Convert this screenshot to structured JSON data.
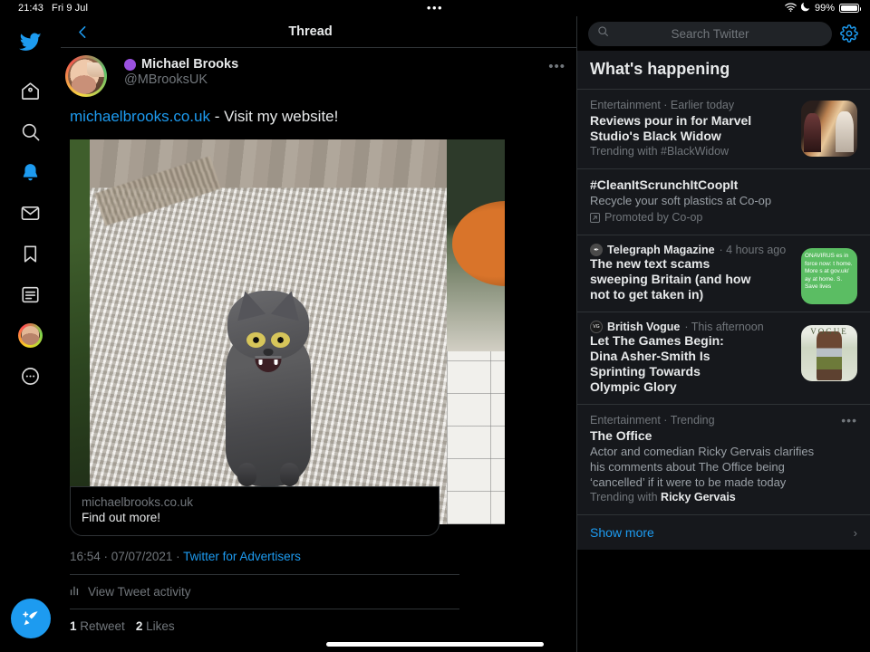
{
  "statusbar": {
    "time": "21:43",
    "date": "Fri 9 Jul",
    "battery_percent": "99%",
    "wifi_icon": "wifi-icon",
    "dnd_icon": "moon-icon",
    "battery_icon": "battery-icon"
  },
  "sidebar": {
    "logo": "twitter-logo",
    "items": [
      {
        "name": "home-icon",
        "label": "Home",
        "active": false
      },
      {
        "name": "search-icon",
        "label": "Explore",
        "active": false
      },
      {
        "name": "bell-icon",
        "label": "Notifications",
        "active": true
      },
      {
        "name": "mail-icon",
        "label": "Messages",
        "active": false
      },
      {
        "name": "bookmark-icon",
        "label": "Bookmarks",
        "active": false
      },
      {
        "name": "list-icon",
        "label": "Lists",
        "active": false
      },
      {
        "name": "avatar-icon",
        "label": "Profile",
        "active": false
      },
      {
        "name": "more-icon",
        "label": "More",
        "active": false
      }
    ],
    "compose_label": "Tweet",
    "compose_icon": "compose-feather-icon"
  },
  "center": {
    "header_title": "Thread",
    "back_icon": "chevron-left-icon",
    "tweet": {
      "display_name": "Michael Brooks",
      "handle": "@MBrooksUK",
      "badge": "purple-circle-badge",
      "more_icon": "more-horizontal-icon",
      "text_link": "michaelbrooks.co.uk",
      "text_rest": " - Visit my website!",
      "media_alt": "grey cat sitting on a cream woven rug",
      "card": {
        "domain": "michaelbrooks.co.uk",
        "cta": "Find out more!"
      },
      "timestamp": "16:54 · 07/07/2021 · ",
      "source": "Twitter for Advertisers",
      "activity_label": "View Tweet activity",
      "activity_icon": "bar-chart-icon",
      "retweet_count": "1",
      "retweet_label": "Retweet",
      "like_count": "2",
      "like_label": "Likes"
    }
  },
  "right": {
    "search_placeholder": "Search Twitter",
    "search_icon": "search-icon",
    "settings_icon": "gear-icon",
    "whats_happening_title": "What's happening",
    "trends": [
      {
        "category": "Entertainment · Earlier today",
        "title": "Reviews pour in for Marvel Studio's Black Widow",
        "sub_prefix": "Trending with ",
        "sub_bold": "#BlackWidow",
        "thumb": "black-widow-poster-thumbnail"
      },
      {
        "title": "#CleanItScrunchItCoopIt",
        "description": "Recycle your soft plastics at Co-op",
        "promoted": "Promoted by Co-op",
        "promoted_icon": "promoted-arrow-icon"
      },
      {
        "source": "Telegraph Magazine",
        "source_icon": "telegraph-logo-icon",
        "time": "· 4 hours ago",
        "title": "The new text scams sweeping Britain (and how not to get taken in)",
        "thumb": "green-sms-screenshot-thumbnail",
        "thumb_text": "ONAVIRUS es in force now: t home. More s at gov.uk/ ay at home. S. Save lives"
      },
      {
        "source": "British Vogue",
        "source_icon": "vogue-logo-icon",
        "time": "· This afternoon",
        "title": "Let The Games Begin: Dina Asher-Smith Is Sprinting Towards Olympic Glory",
        "thumb": "vogue-cover-thumbnail"
      },
      {
        "category": "Entertainment · Trending",
        "title": "The Office",
        "description": "Actor and comedian Ricky Gervais clarifies his comments about The Office being ‘cancelled’ if it were to be made today",
        "sub_prefix": "Trending with ",
        "sub_bold": "Ricky Gervais",
        "dots_icon": "more-horizontal-icon"
      }
    ],
    "show_more": "Show more",
    "show_more_icon": "chevron-right-icon"
  },
  "colors": {
    "accent": "#1d9bf0",
    "background": "#000000",
    "panel": "#16181c",
    "border": "#2f3336",
    "muted_text": "#71767b",
    "primary_text": "#e7e9ea",
    "badge_purple": "#9b51e0"
  }
}
